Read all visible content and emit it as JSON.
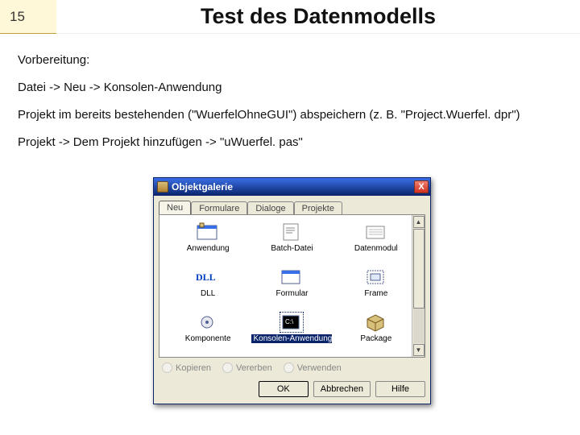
{
  "slide": {
    "number": "15",
    "title": "Test des Datenmodells",
    "paragraphs": [
      "Vorbereitung:",
      "Datei -> Neu -> Konsolen-Anwendung",
      "Projekt im bereits bestehenden (\"WuerfelOhneGUI\") abspeichern (z. B. \"Project.Wuerfel. dpr\")",
      "Projekt -> Dem Projekt hinzufügen -> \"uWuerfel. pas\""
    ]
  },
  "dialog": {
    "title": "Objektgalerie",
    "close_label": "X",
    "tabs": [
      "Neu",
      "Formulare",
      "Dialoge",
      "Projekte"
    ],
    "tab_active": 0,
    "icons": [
      {
        "name": "anwendung-icon",
        "label": "Anwendung"
      },
      {
        "name": "batch-datei-icon",
        "label": "Batch-Datei"
      },
      {
        "name": "datenmodul-icon",
        "label": "Datenmodul"
      },
      {
        "name": "dll-icon",
        "label": "DLL"
      },
      {
        "name": "formular-icon",
        "label": "Formular"
      },
      {
        "name": "frame-icon",
        "label": "Frame"
      },
      {
        "name": "komponente-icon",
        "label": "Komponente"
      },
      {
        "name": "konsolen-anwendung-icon",
        "label": "Konsolen-Anwendung"
      },
      {
        "name": "package-icon",
        "label": "Package"
      }
    ],
    "icon_selected": 7,
    "radios": {
      "copy": "Kopieren",
      "inherit": "Vererben",
      "use": "Verwenden"
    },
    "buttons": {
      "ok": "OK",
      "cancel": "Abbrechen",
      "help": "Hilfe"
    }
  }
}
